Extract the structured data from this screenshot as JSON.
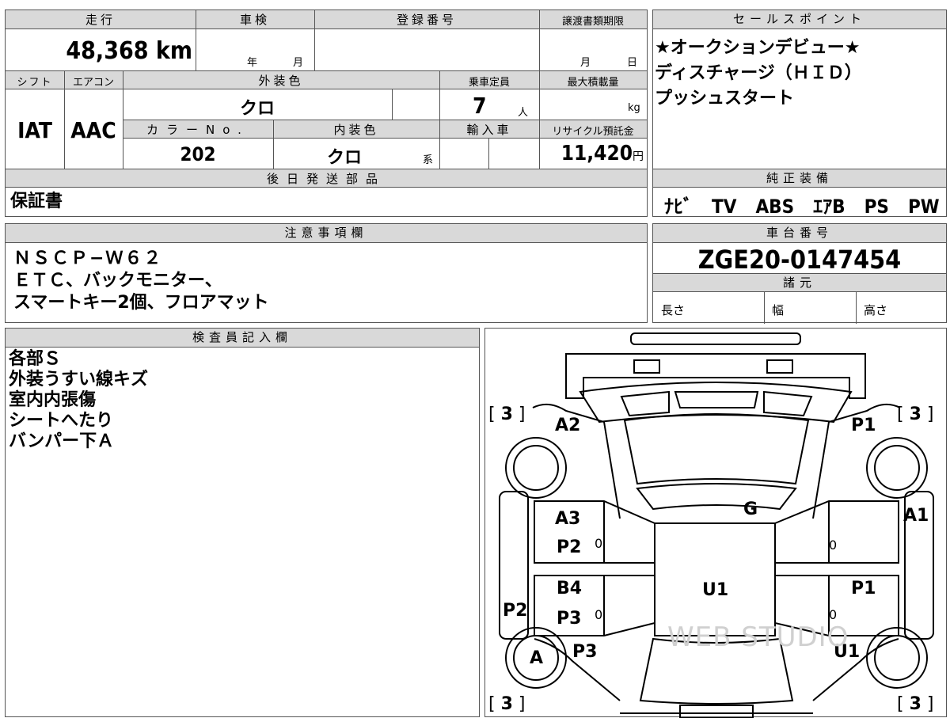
{
  "top": {
    "mileage_label": "走行",
    "mileage_value": "48,368",
    "mileage_unit": "km",
    "inspection_label": "車検",
    "inspection_year": "年",
    "inspection_month": "月",
    "registration_label": "登録番号",
    "transfer_label": "譲渡書類期限",
    "transfer_month": "月",
    "transfer_day": "日"
  },
  "row2": {
    "shift_label": "シフト",
    "shift_value": "IAT",
    "ac_label": "エアコン",
    "ac_value": "AAC",
    "exterior_label": "外装色",
    "exterior_value": "クロ",
    "capacity_label": "乗車定員",
    "capacity_value": "7",
    "capacity_unit": "人",
    "max_load_label": "最大積載量",
    "max_load_unit": "kg",
    "color_no_label": "カラーNo.",
    "color_no_value": "202",
    "interior_label": "内装色",
    "interior_value": "クロ",
    "interior_suffix": "系",
    "import_label": "輸入車",
    "recycle_label": "リサイクル預託金",
    "recycle_value": "11,420",
    "recycle_unit": "円"
  },
  "later_parts": {
    "label": "後日発送部品",
    "value": "保証書"
  },
  "sales": {
    "label": "セールスポイント",
    "lines": [
      "★オークションデビュー★",
      "ディスチャージ（ＨＩＤ）",
      "プッシュスタート"
    ]
  },
  "equipment": {
    "label": "純正装備",
    "value": "ﾅﾋﾞ　TV　ABS　ｴｱB　PS　PW"
  },
  "notes": {
    "label": "注意事項欄",
    "lines": [
      "ＮＳＣＰ−Ｗ６２",
      "ＥＴＣ、バックモニター、",
      "スマートキー2個、フロアマット"
    ]
  },
  "chassis": {
    "label": "車台番号",
    "value": "ZGE20-0147454",
    "spec_label": "諸元",
    "length_label": "長さ",
    "width_label": "幅",
    "height_label": "高さ"
  },
  "inspector": {
    "label": "検査員記入欄",
    "lines": [
      "各部Ｓ",
      "外装うすい線キズ",
      "室内内張傷",
      "シートへたり",
      "バンパー下Ａ"
    ]
  },
  "diagram": {
    "tire_fl": "3",
    "tire_fr": "3",
    "tire_rl": "3",
    "tire_rr": "3",
    "marks": {
      "a2": "A2",
      "p1_front": "P1",
      "g": "G",
      "a1": "A1",
      "a3": "A3",
      "p2_left_door": "P2",
      "b4": "B4",
      "p3_left_door": "P3",
      "p2_left_side": "P2",
      "u1_center": "U1",
      "p1_right_door": "P1",
      "a_wheel": "A",
      "p3_rear_left": "P3",
      "u1_rear_right": "U1"
    },
    "zero": "0",
    "watermark": "WEB STUDIO"
  }
}
